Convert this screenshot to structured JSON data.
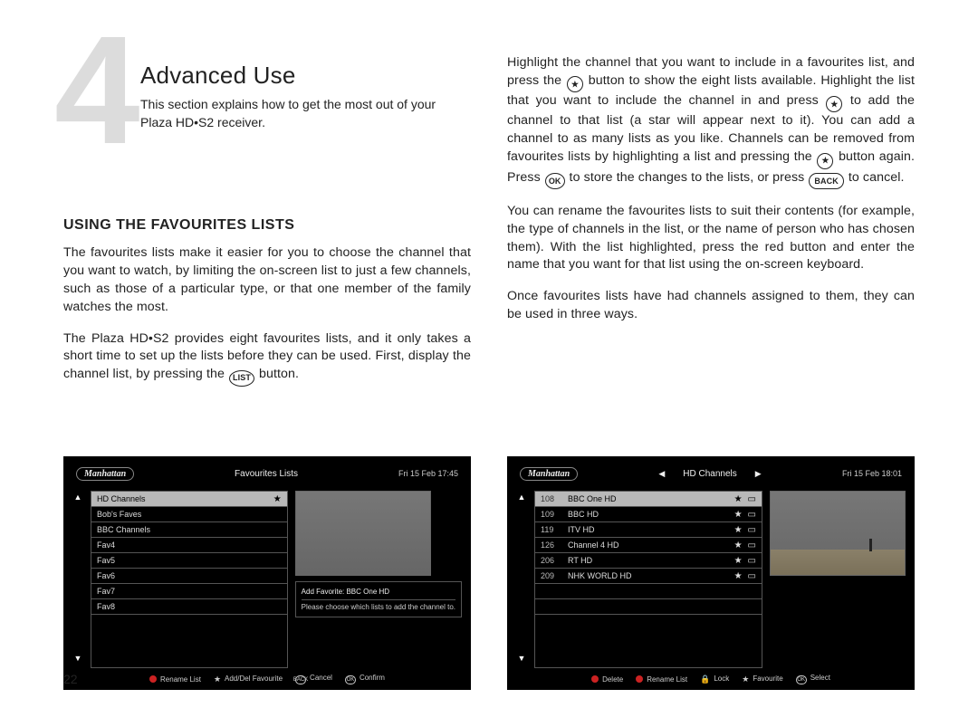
{
  "chapter": {
    "number": "4",
    "title": "Advanced Use",
    "intro": "This section explains how to get the most out of your Plaza HD•S2 receiver."
  },
  "section_heading": "USING THE FAVOURITES LISTS",
  "left_p1": "The favourites lists make it easier for you to choose the channel that you want to watch, by limiting the on-screen list to just a few channels, such as those of a particular type, or that one member of the family watches the most.",
  "left_p2a": "The Plaza HD•S2 provides eight favourites lists, and it only takes a short time to set up the lists before they can be used. First, display the channel list, by pressing the ",
  "left_p2_btn": "LIST",
  "left_p2b": " button.",
  "right_p1a": "Highlight the channel that you want to include in a favourites list, and press the ",
  "right_p1b": " button to show the eight lists available. Highlight the list that you want to include the channel in and press ",
  "right_p1c": " to add the channel to that list (a star will appear next to it). You can add a channel to as many lists as you like. Channels can be removed from favourites lists by highlighting a list and pressing the ",
  "right_p1d": " button again. Press ",
  "right_p1e": " to store the changes to the lists, or press ",
  "right_p1f": " to cancel.",
  "btn_star": "★",
  "btn_ok": "OK",
  "btn_back": "BACK",
  "right_p2": "You can rename the favourites lists to suit their contents (for example, the type of channels in the list, or the name of person who has chosen them). With the list highlighted, press the red button and enter the name that you want for that list using the on-screen keyboard.",
  "right_p3": "Once favourites lists have had channels assigned to them, they can be used in three ways.",
  "page_number": "22",
  "ss1": {
    "logo": "Manhattan",
    "title": "Favourites Lists",
    "time": "Fri 15 Feb 17:45",
    "rows": [
      {
        "label": "HD Channels",
        "star": true,
        "sel": true
      },
      {
        "label": "Bob's Faves"
      },
      {
        "label": "BBC Channels"
      },
      {
        "label": "Fav4"
      },
      {
        "label": "Fav5"
      },
      {
        "label": "Fav6"
      },
      {
        "label": "Fav7"
      },
      {
        "label": "Fav8"
      }
    ],
    "info_title": "Add Favorite: BBC One HD",
    "info_text": "Please choose which lists to add the channel to.",
    "footer": [
      {
        "icon": "red",
        "label": "Rename List"
      },
      {
        "icon": "star",
        "label": "Add/Del Favourite"
      },
      {
        "icon": "back",
        "label": "Cancel"
      },
      {
        "icon": "ok",
        "label": "Confirm"
      }
    ]
  },
  "ss2": {
    "logo": "Manhattan",
    "title": "HD Channels",
    "time": "Fri 15 Feb 18:01",
    "rows": [
      {
        "num": "108",
        "label": "BBC One HD",
        "star": true,
        "tv": true,
        "sel": true
      },
      {
        "num": "109",
        "label": "BBC HD",
        "star": true,
        "tv": true
      },
      {
        "num": "119",
        "label": "ITV HD",
        "star": true,
        "tv": true
      },
      {
        "num": "126",
        "label": "Channel 4 HD",
        "star": true,
        "tv": true
      },
      {
        "num": "206",
        "label": "RT HD",
        "star": true,
        "tv": true
      },
      {
        "num": "209",
        "label": "NHK WORLD HD",
        "star": true,
        "tv": true
      },
      {},
      {}
    ],
    "footer": [
      {
        "icon": "red",
        "label": "Delete"
      },
      {
        "icon": "red",
        "label": "Rename List"
      },
      {
        "icon": "lock",
        "label": "Lock"
      },
      {
        "icon": "star",
        "label": "Favourite"
      },
      {
        "icon": "ok",
        "label": "Select"
      }
    ]
  }
}
